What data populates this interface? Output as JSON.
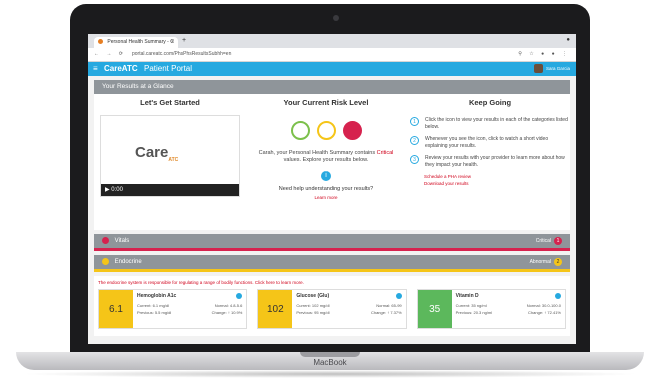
{
  "browser": {
    "tab_title": "Personal Health Summary - C",
    "url": "portal.careatc.com/PhsPhsResultsSubhh=en"
  },
  "app": {
    "logo": "CareATC",
    "portal_title": "Patient Portal",
    "user_name": "Sara Garcia"
  },
  "glance": {
    "title": "Your Results at a Glance"
  },
  "get_started": {
    "title": "Let's Get Started",
    "video_logo": "Care",
    "video_logo_sub": "ATC",
    "video_time": "0:00"
  },
  "risk": {
    "title": "Your Current Risk Level",
    "text_before": "Carah, your Personal Health Summary contains ",
    "critical": "Critical",
    "text_after": " values. Explore your results below.",
    "help": "Need help understanding your results?",
    "learn_more": "Learn more",
    "colors": {
      "low": "#7cc04b",
      "medium": "#f5c518",
      "high": "#d6224e"
    }
  },
  "keep_going": {
    "title": "Keep Going",
    "steps": [
      {
        "num": "1",
        "text": "Click the icon to view your results in each of the categories listed below."
      },
      {
        "num": "2",
        "text": "Whenever you see the icon, click to watch a short video explaining your results."
      },
      {
        "num": "3",
        "text": "Review your results with your provider to learn more about how they impact your health."
      }
    ],
    "link_schedule": "Schedule a PHA review",
    "link_download": "Download your results"
  },
  "vitals": {
    "label": "Vitals",
    "status": "Critical",
    "count": "1",
    "color": "#d6224e"
  },
  "endocrine": {
    "label": "Endocrine",
    "status": "Abnormal",
    "count": "2",
    "color": "#f5c518",
    "note": "The endocrine system is responsible for regulating a range of bodily functions. Click here to learn more.",
    "tiles": [
      {
        "value": "6.1",
        "name": "Hemoglobin A1c",
        "current_label": "Current:",
        "current": "6.1 mg/dl",
        "normal_label": "Normal:",
        "normal": "4.8-5.6",
        "previous_label": "Previous:",
        "previous": "5.5 mg/dl",
        "change_label": "Change:",
        "change": "10.9%",
        "color": "#f5c518"
      },
      {
        "value": "102",
        "name": "Glucose (Glu)",
        "current_label": "Current:",
        "current": "102 mg/dl",
        "normal_label": "Normal:",
        "normal": "65-99",
        "previous_label": "Previous:",
        "previous": "95 mg/dl",
        "change_label": "Change:",
        "change": "7.37%",
        "color": "#f5c518"
      },
      {
        "value": "35",
        "name": "Vitamin D",
        "current_label": "Current:",
        "current": "35 ng/ml",
        "normal_label": "Normal:",
        "normal": "30.0-100.0",
        "previous_label": "Previous:",
        "previous": "20.3 ng/ml",
        "change_label": "Change:",
        "change": "72.41%",
        "color": "#5cb85c"
      }
    ]
  },
  "device": {
    "brand": "MacBook"
  }
}
